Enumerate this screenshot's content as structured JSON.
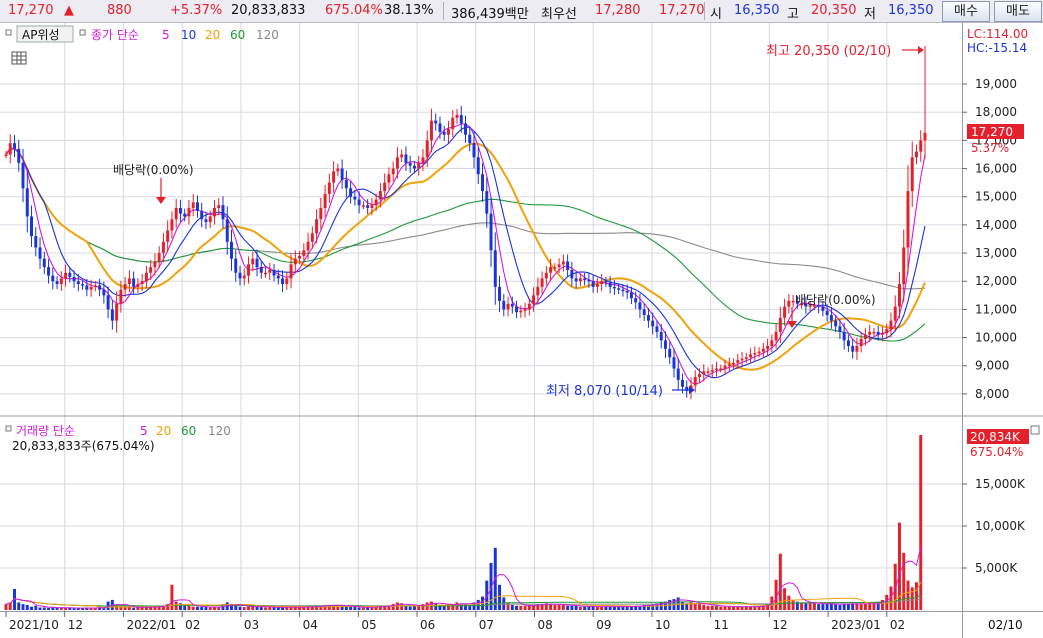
{
  "quote_bar": {
    "price": "17,270",
    "arrow": "▲",
    "change": "880",
    "change_pct": "+5.37%",
    "volume": "20,833,833",
    "volume_pct": "675.04%",
    "turnover": "38.13%",
    "amount": "386,439백만",
    "best_bid_label": "최우선",
    "best_ask": "17,280",
    "best_bid": "17,270",
    "open_label": "시",
    "open": "16,350",
    "high_label": "고",
    "high": "20,350",
    "low_label": "저",
    "low": "16,350",
    "buy_button": "매수",
    "sell_button": "매도"
  },
  "price_panel": {
    "indicator_button": "AP위성",
    "legend_label": "종가 단순",
    "ma_periods": [
      "5",
      "10",
      "20",
      "60",
      "120"
    ],
    "lc_label": "LC:114.00",
    "hc_label": "HC:-15.14",
    "price_tag": "17,270",
    "pct_tag": "5.37%",
    "high_annotation": "최고 20,350 (02/10)",
    "low_annotation": "최저 8,070 (10/14)",
    "dividend_label_1": "배당락(0.00%)",
    "dividend_label_2": "배당락(0.00%)",
    "y_ticks": [
      "19,000",
      "18,000",
      "17,000",
      "16,000",
      "15,000",
      "14,000",
      "13,000",
      "12,000",
      "11,000",
      "10,000",
      "9,000",
      "8,000"
    ]
  },
  "volume_panel": {
    "legend_label": "거래량 단순",
    "ma_periods": [
      "5",
      "20",
      "60",
      "120"
    ],
    "summary": "20,833,833주(675.04%)",
    "tag_value": "20,834K",
    "tag_pct": "675.04%",
    "y_ticks": [
      "15,000K",
      "10,000K",
      "5,000K"
    ]
  },
  "x_axis": {
    "labels": [
      "2021/10",
      "12",
      "2022/01",
      "02",
      "03",
      "04",
      "05",
      "06",
      "07",
      "08",
      "09",
      "10",
      "11",
      "12",
      "2023/01",
      "02"
    ],
    "current_date": "02/10"
  },
  "colors": {
    "up": "#e3202c",
    "down": "#1b34d8",
    "ma5": "#d21adc",
    "ma10": "#1b34d8",
    "ma20": "#f0a20a",
    "ma60": "#1f9a3a",
    "ma120": "#8a8a8a",
    "grid": "#d8d8e0"
  },
  "chart_data": {
    "type": "candlestick",
    "price_axis": {
      "min": 7500,
      "max": 20350
    },
    "volume_axis_k": {
      "min": 0,
      "max": 20834
    },
    "closes": [
      16500,
      16900,
      16700,
      16200,
      15300,
      14300,
      13600,
      13200,
      12800,
      12500,
      12200,
      12000,
      11900,
      12100,
      12300,
      12150,
      12000,
      11900,
      11850,
      11700,
      11800,
      11850,
      11700,
      11500,
      11000,
      10600,
      11200,
      11700,
      11900,
      12100,
      11800,
      11900,
      12000,
      12300,
      12500,
      12700,
      13000,
      13400,
      13800,
      14200,
      14600,
      14400,
      14300,
      14600,
      14800,
      14500,
      14200,
      14100,
      14300,
      14600,
      14700,
      14200,
      13400,
      12800,
      12300,
      12100,
      12200,
      12600,
      12800,
      12500,
      12300,
      12300,
      12400,
      12200,
      12100,
      11900,
      12100,
      12600,
      12800,
      12900,
      13100,
      13400,
      13700,
      14200,
      14600,
      15100,
      15500,
      15900,
      16000,
      15600,
      15300,
      15000,
      14900,
      14700,
      14700,
      14600,
      14700,
      14900,
      15200,
      15500,
      15800,
      16000,
      16400,
      16500,
      16200,
      16100,
      16000,
      16200,
      16400,
      17000,
      17700,
      17600,
      17300,
      17200,
      17400,
      17800,
      17900,
      17600,
      17200,
      16900,
      16400,
      15800,
      15200,
      14400,
      13100,
      11800,
      11300,
      11000,
      11200,
      11100,
      10900,
      10950,
      11000,
      11200,
      11500,
      11800,
      12100,
      12300,
      12500,
      12500,
      12600,
      12700,
      12400,
      12100,
      12000,
      12100,
      12050,
      12000,
      11800,
      11900,
      12000,
      11950,
      11800,
      11750,
      11700,
      11650,
      11600,
      11400,
      11250,
      11000,
      10800,
      10600,
      10400,
      10200,
      9900,
      9600,
      9300,
      8900,
      8500,
      8250,
      8100,
      8300,
      8600,
      8700,
      8800,
      8800,
      8850,
      8900,
      8900,
      9000,
      9050,
      9100,
      9200,
      9250,
      9300,
      9400,
      9450,
      9500,
      9600,
      9700,
      9900,
      10200,
      10700,
      11100,
      11300,
      11300,
      11200,
      11200,
      11100,
      11150,
      11150,
      11100,
      10950,
      10800,
      10600,
      10400,
      10200,
      9900,
      9700,
      9500,
      9700,
      9950,
      10100,
      10200,
      10200,
      10100,
      10150,
      10300,
      10600,
      11100,
      11900,
      13200,
      15200,
      16400,
      16600,
      17000,
      17270
    ],
    "volumes_k": [
      700,
      900,
      2500,
      900,
      700,
      600,
      400,
      500,
      300,
      300,
      250,
      300,
      250,
      300,
      250,
      250,
      200,
      200,
      250,
      300,
      250,
      200,
      300,
      200,
      1000,
      1200,
      500,
      300,
      400,
      400,
      250,
      300,
      300,
      400,
      350,
      400,
      500,
      500,
      700,
      3000,
      1000,
      800,
      500,
      500,
      400,
      400,
      350,
      350,
      300,
      400,
      350,
      700,
      900,
      600,
      500,
      400,
      350,
      400,
      500,
      400,
      350,
      300,
      350,
      300,
      350,
      300,
      300,
      400,
      350,
      300,
      350,
      400,
      400,
      500,
      500,
      600,
      600,
      600,
      500,
      500,
      400,
      400,
      350,
      300,
      300,
      300,
      400,
      400,
      500,
      500,
      500,
      700,
      900,
      800,
      500,
      400,
      450,
      600,
      700,
      900,
      1000,
      800,
      600,
      500,
      600,
      700,
      900,
      800,
      700,
      600,
      900,
      1200,
      1600,
      3500,
      5600,
      7400,
      3000,
      1500,
      900,
      600,
      500,
      500,
      500,
      600,
      600,
      700,
      700,
      800,
      700,
      600,
      600,
      600,
      500,
      500,
      500,
      400,
      400,
      400,
      450,
      400,
      400,
      400,
      400,
      400,
      400,
      400,
      400,
      450,
      500,
      500,
      600,
      600,
      700,
      800,
      900,
      1000,
      1200,
      1300,
      1500,
      1000,
      800,
      900,
      800,
      700,
      600,
      500,
      500,
      500,
      400,
      400,
      400,
      400,
      400,
      400,
      400,
      400,
      400,
      450,
      500,
      700,
      1600,
      3600,
      6700,
      2600,
      1700,
      1200,
      1000,
      900,
      800,
      800,
      800,
      700,
      700,
      700,
      800,
      700,
      600,
      700,
      700,
      800,
      800,
      700,
      700,
      700,
      800,
      900,
      1200,
      1800,
      2800,
      5500,
      10400,
      6800,
      3500,
      2700,
      3300,
      20834
    ]
  }
}
